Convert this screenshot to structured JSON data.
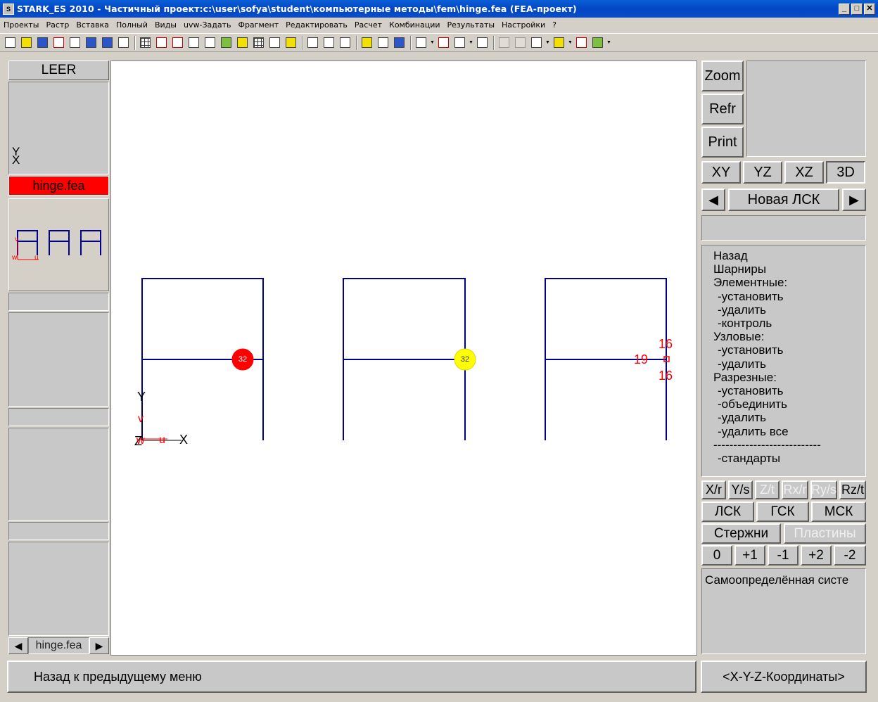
{
  "window": {
    "title": "STARK_ES 2010 - Частичный проект:c:\\user\\sofya\\student\\компьютерные методы\\fem\\hinge.fea  (FEA-проект)",
    "minimize": "_",
    "maximize": "□",
    "close": "✕"
  },
  "menu": [
    "Проекты",
    "Растр",
    "Вставка",
    "Полный",
    "Виды",
    "uvw-Задать",
    "Фрагмент",
    "Редактировать",
    "Расчет",
    "Комбинации",
    "Результаты",
    "Настройки",
    "?"
  ],
  "left_panel": {
    "title": "LEER",
    "axis_y": "Y",
    "axis_x": "X",
    "active_file": "hinge.fea",
    "thumb_v": "v",
    "thumb_w": "w",
    "thumb_u": "u",
    "nav_prev": "◀",
    "nav_next": "▶",
    "nav_file": "hinge.fea"
  },
  "canvas": {
    "axis_y": "Y",
    "axis_v": "v",
    "axis_z": "Z",
    "axis_w": "w",
    "axis_u": "u",
    "axis_x": "X",
    "hinge1_label": "32",
    "hinge2_label": "32",
    "hinge3_top": "16",
    "hinge3_left": "19",
    "hinge3_bottom": "16",
    "colors": {
      "frame": "#00008b",
      "hinge1": "#ff0000",
      "hinge2": "#ffff00",
      "labels": "#ff0000",
      "axes": "#000000"
    }
  },
  "right_panel": {
    "zoom": "Zoom",
    "refr": "Refr",
    "print": "Print",
    "views": [
      "XY",
      "YZ",
      "XZ",
      "3D"
    ],
    "prev": "◀",
    "next": "▶",
    "lsk": "Новая ЛСК",
    "menu": [
      {
        "label": "Назад",
        "sub": false
      },
      {
        "label": "Шарниры",
        "sub": false
      },
      {
        "label": "Элементные:",
        "sub": false
      },
      {
        "label": "-установить",
        "sub": true
      },
      {
        "label": "-удалить",
        "sub": true
      },
      {
        "label": "-контроль",
        "sub": true
      },
      {
        "label": "Узловые:",
        "sub": false
      },
      {
        "label": "-установить",
        "sub": true
      },
      {
        "label": "-удалить",
        "sub": true
      },
      {
        "label": "Разрезные:",
        "sub": false
      },
      {
        "label": "-установить",
        "sub": true
      },
      {
        "label": "-объединить",
        "sub": true
      },
      {
        "label": "-удалить",
        "sub": true
      },
      {
        "label": "-удалить все",
        "sub": true
      },
      {
        "label": "---------------------------",
        "sub": false
      },
      {
        "label": "-стандарты",
        "sub": true
      }
    ],
    "dof": [
      "X/r",
      "Y/s",
      "Z/t",
      "Rx/r",
      "Ry/s",
      "Rz/t"
    ],
    "systems": [
      "ЛСК",
      "ГСК",
      "МСК"
    ],
    "rods": "Стержни",
    "plates": "Пластины",
    "steps": [
      "0",
      "+1",
      "-1",
      "+2",
      "-2"
    ],
    "info": "Самоопределённая систе"
  },
  "status": {
    "left": "Назад к предыдущему меню",
    "right": "<X-Y-Z-Координаты>"
  }
}
